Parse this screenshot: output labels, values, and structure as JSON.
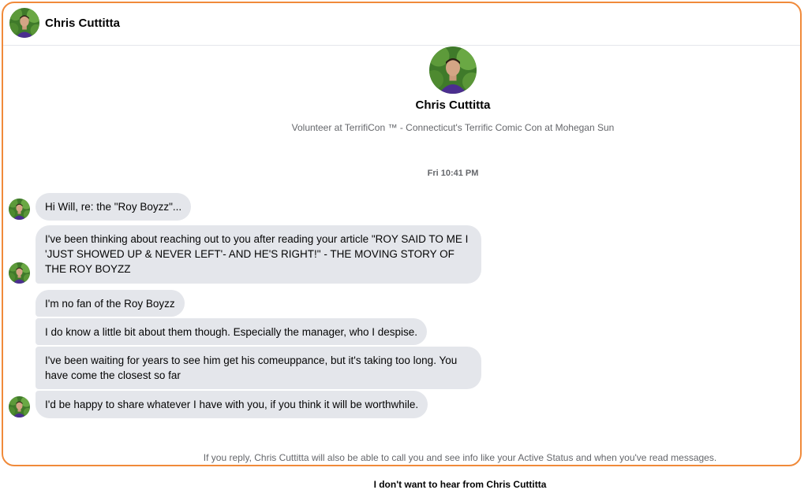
{
  "header": {
    "contact_name": "Chris Cuttitta"
  },
  "profile": {
    "name": "Chris Cuttitta",
    "subtitle": "Volunteer at TerrifiCon ™ - Connecticut's Terrific Comic Con at Mohegan Sun"
  },
  "conversation": {
    "timestamp": "Fri 10:41 PM",
    "messages": [
      "Hi Will, re: the \"Roy Boyzz\"...",
      "I've been thinking about reaching out to you after reading your article \"ROY SAID TO ME I 'JUST SHOWED UP & NEVER LEFT'- AND HE'S RIGHT!\" - THE MOVING STORY OF THE ROY BOYZZ",
      "I'm no fan of the Roy Boyzz",
      "I do know a little bit about them though. Especially the manager, who I despise.",
      "I've been waiting for years to see him get his comeuppance, but it's taking too long. You have come the closest so far",
      "I'd be happy to share whatever I have with you, if you think it will be worthwhile."
    ]
  },
  "footer": {
    "note": "If you reply, Chris Cuttitta will also be able to call you and see info like your Active Status and when you've read messages.",
    "action": "I don't want to hear from Chris Cuttitta"
  },
  "colors": {
    "frame_border": "#f08a3a",
    "bubble_bg": "#e4e6eb",
    "secondary_text": "#65676b"
  }
}
